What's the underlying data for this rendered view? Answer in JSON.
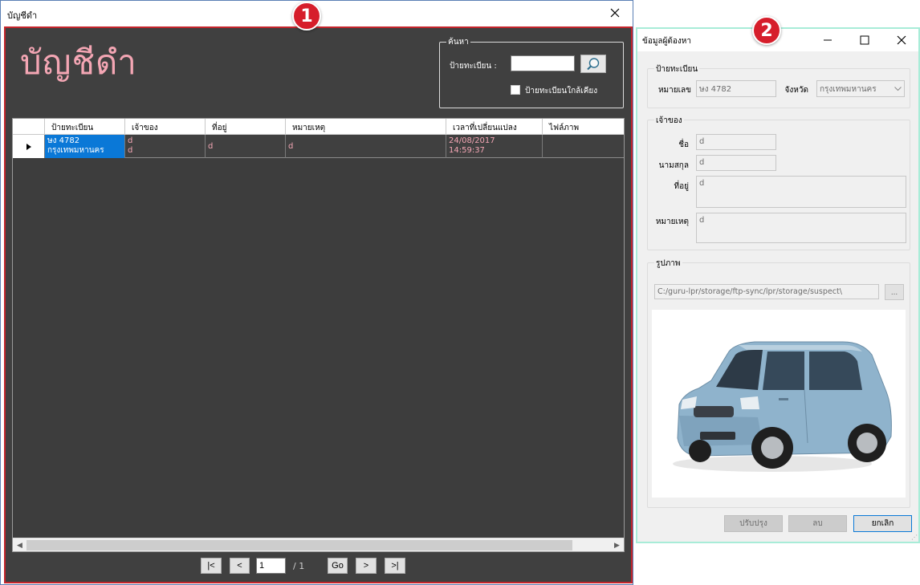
{
  "main_window": {
    "title": "บัญชีดำ",
    "heading": "บัญชีดำ",
    "search": {
      "legend": "ค้นหา",
      "plate_label": "ป้ายทะเบียน :",
      "plate_value": "",
      "near_label": "ป้ายทะเบียนใกล้เคียง",
      "near_checked": false
    },
    "grid": {
      "columns": [
        "ป้ายทะเบียน",
        "เจ้าของ",
        "ที่อยู่",
        "หมายเหตุ",
        "เวลาที่เปลี่ยนแปลง",
        "ไฟล์ภาพ"
      ],
      "rows": [
        {
          "plate": "ษง 4782",
          "province": "กรุงเทพมหานคร",
          "owner_first": "d",
          "owner_last": "d",
          "address": "d",
          "note": "d",
          "date": "24/08/2017",
          "time": "14:59:37",
          "image": ""
        }
      ]
    },
    "pager": {
      "first": "|<",
      "prev": "<",
      "page": "1",
      "total": "/ 1",
      "go": "Go",
      "next": ">",
      "last": ">|"
    }
  },
  "badges": {
    "one": "1",
    "two": "2"
  },
  "detail_window": {
    "title": "ข้อมูลผู้ต้องหา",
    "plate_group": {
      "legend": "ป้ายทะเบียน",
      "number_label": "หมายเลข",
      "number_value": "ษง 4782",
      "province_label": "จังหวัด",
      "province_value": "กรุงเทพมหานคร"
    },
    "owner_group": {
      "legend": "เจ้าของ",
      "first_label": "ชื่อ",
      "first_value": "d",
      "last_label": "นามสกุล",
      "last_value": "d",
      "address_label": "ที่อยู่",
      "address_value": "d",
      "note_label": "หมายเหตุ",
      "note_value": "d"
    },
    "image_group": {
      "legend": "รูปภาพ",
      "path": "C:/guru-lpr/storage/ftp-sync/lpr/storage/suspect\\",
      "browse_label": "..."
    },
    "buttons": {
      "update": "ปรับปรุง",
      "delete": "ลบ",
      "cancel": "ยกเลิก"
    }
  },
  "colors": {
    "dark_bg": "#404040",
    "pink_text": "#f4a6b4",
    "selection_blue": "#0a78d7",
    "highlight_red": "#c4252c",
    "highlight_mint": "#a8ecd8",
    "car_body": "#8fb3cc"
  },
  "icons": {
    "search_button": "magnifier-icon",
    "row_indicator": "row-pointer-icon",
    "close": "close-icon",
    "minimize": "minimize-icon",
    "maximize": "maximize-icon",
    "province_dropdown": "chevron-down-icon"
  }
}
